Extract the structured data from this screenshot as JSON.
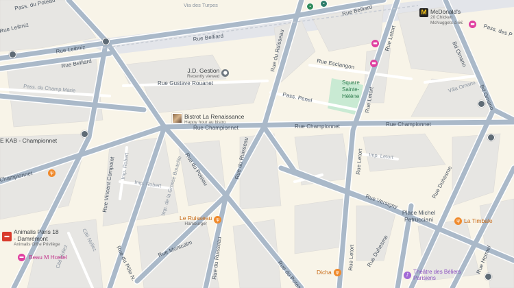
{
  "colors": {
    "land": "#f8f4e8",
    "block": "#e8e7e4",
    "road": "#aab9c9",
    "road_outline": "#ffffff",
    "park": "#c9ead3",
    "rail": "#dfe3e8",
    "food": "#f08a2c",
    "lodging": "#e040a0",
    "entertainment": "#a36ad6"
  },
  "streets": {
    "passage_du_poteau": "Pass. du Poteau",
    "via_des_turpes": "Via des Turpes",
    "rue_belliard_left": "Rue Belliard",
    "rue_belliard_mid": "Rue Belliard",
    "rue_belliard_right": "Rue Belliard",
    "rue_leibniz_1": "Rue Leibniz",
    "rue_leibniz_2": "Rue Leibniz",
    "rue_gustave_rouanet": "Rue Gustave Rouanet",
    "pass_du_champ_marie": "Pass. du Champ Marie",
    "rue_championnet_left": "Rue Championnet",
    "rue_championnet_mid": "Rue Championnet",
    "rue_championnet_right": "Rue Championnet",
    "championnet_far_left": "Championnet",
    "rue_du_ruisseau_top": "Rue du Ruisseau",
    "rue_du_ruisseau_mid": "Rue du Ruisseau",
    "rue_du_ruisseau_bottom": "Rue du Ruisseau",
    "rue_des_clangen": "Rue Esclangon",
    "pass_penel": "Pass. Penel",
    "rue_letort_top": "Rue Letort",
    "rue_letort_mid": "Rue Letort",
    "rue_letort_low": "Rue Letort",
    "rue_letort_bottom": "Rue Letort",
    "imp_letort": "Imp. Letort",
    "bd_ornano_top": "Bd Ornano",
    "bd_ornano_mid": "Bd Ornano",
    "villa_ornano": "Villa Ornano",
    "pass_des_poissonniers": "Pass. des P",
    "rue_duhesme_right": "Rue Duhesme",
    "rue_duhesme_bottom": "Rue Duhesme",
    "rue_hermel": "Rue Hermel",
    "rue_versigny": "Rue Versigny",
    "rue_du_poteau_mid": "Rue du Poteau",
    "rue_du_poteau_bottom": "Rue du Poteau",
    "rue_vincent_compoint": "Rue Vincent Compoint",
    "imp_robert_1": "Imp. Robert",
    "imp_robert_2": "Imp. Robert",
    "imp_de_la_grosse_bouteille": "Imp. de la Grosse Bouteille",
    "rue_montcalm": "Rue Montcalm",
    "rue_du_pole_n": "Rue du Pôle N.",
    "cite_nollez_1": "Cité Nollez",
    "cite_nollez_2": "Cité Nollez",
    "rue_letort_b2": "Rue Letort"
  },
  "pois": {
    "jd_gestion": {
      "name": "J.D. Gestion",
      "sub": "Recently viewed"
    },
    "bistrot": {
      "name": "Bistrot La Renaissance",
      "sub": "Happy hour au bistro"
    },
    "mcdonalds": {
      "name": "McDonald's",
      "sub": "20 Chicken McNuggets à 6€"
    },
    "square": {
      "name": "Square Sainte-Hélène"
    },
    "kab": {
      "name": "E KAB - Championnet"
    },
    "le_ruisseau": {
      "name": "Le Ruisseau",
      "sub": "Hamburger"
    },
    "animalis": {
      "name": "Animalis Paris 18 - Damrémont",
      "sub": "Animalis Offre Privilège"
    },
    "beau_m": {
      "name": "Beau M Hostel"
    },
    "place_michel": {
      "name": "Place Michel Petrucciani"
    },
    "la_timbale": {
      "name": "La Timbale"
    },
    "dicha": {
      "name": "Dicha"
    },
    "theatre": {
      "name": "Théâtre des Béliers Parisiens"
    }
  },
  "icons": {
    "restaurant": "fork-knife-icon",
    "hotel": "bed-icon",
    "pin": "location-pin-icon",
    "bus": "bus-stop-icon",
    "transit": "train-icon",
    "theatre": "theatre-icon",
    "fastfood": "mcdonalds-logo-icon",
    "store": "store-icon"
  }
}
